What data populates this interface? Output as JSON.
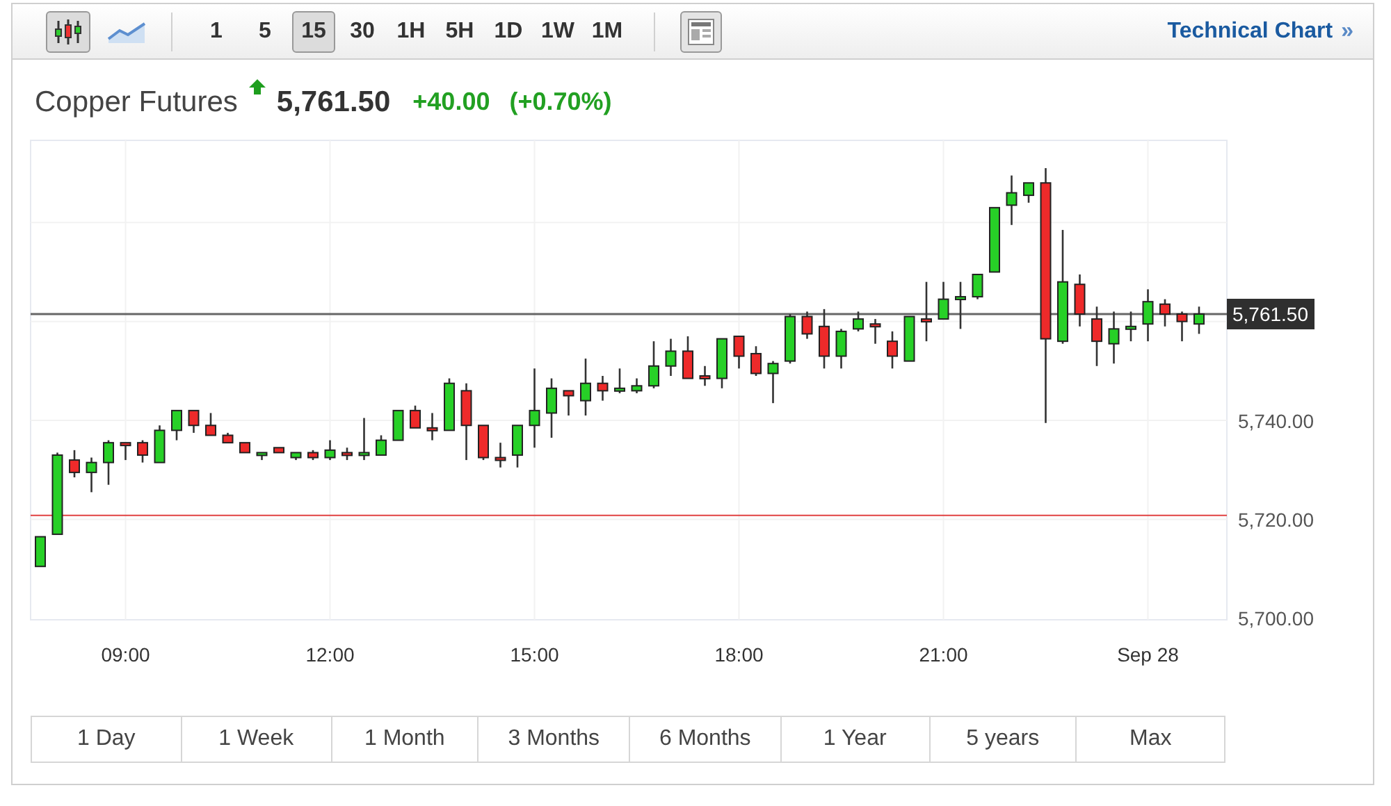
{
  "toolbar": {
    "chart_types": [
      {
        "kind": "candlestick",
        "selected": true
      },
      {
        "kind": "line",
        "selected": false
      }
    ],
    "timeframes": [
      {
        "label": "1",
        "selected": false
      },
      {
        "label": "5",
        "selected": false
      },
      {
        "label": "15",
        "selected": true
      },
      {
        "label": "30",
        "selected": false
      },
      {
        "label": "1H",
        "selected": false
      },
      {
        "label": "5H",
        "selected": false
      },
      {
        "label": "1D",
        "selected": false
      },
      {
        "label": "1W",
        "selected": false
      },
      {
        "label": "1M",
        "selected": false
      }
    ],
    "link": {
      "label": "Technical Chart",
      "arrow": "»"
    }
  },
  "quote": {
    "name": "Copper Futures",
    "rising": true,
    "price": "5,761.50",
    "change": "+40.00",
    "change_percent": "(+0.70%)"
  },
  "chart": {
    "chart_data": {
      "type": "candlestick",
      "categories": [
        null,
        null,
        null,
        null,
        null,
        "09:00",
        null,
        null,
        null,
        null,
        null,
        null,
        null,
        null,
        null,
        null,
        null,
        "12:00",
        null,
        null,
        null,
        null,
        null,
        null,
        null,
        null,
        null,
        null,
        null,
        "15:00",
        null,
        null,
        null,
        null,
        null,
        null,
        null,
        null,
        null,
        null,
        null,
        "18:00",
        null,
        null,
        null,
        null,
        null,
        null,
        null,
        null,
        null,
        null,
        null,
        "21:00",
        null,
        null,
        null,
        null,
        null,
        null,
        null,
        null,
        null,
        null,
        null,
        "Sep 28",
        null,
        null,
        null
      ],
      "ohlc": [
        [
          5710.5,
          5716.5,
          5710.5,
          5716.5
        ],
        [
          5717,
          5733.5,
          5717,
          5733
        ],
        [
          5732,
          5734,
          5728.5,
          5729.5
        ],
        [
          5729.5,
          5732.5,
          5725.5,
          5731.5
        ],
        [
          5731.5,
          5736,
          5727,
          5735.5
        ],
        [
          5735.5,
          5735.5,
          5732,
          5735
        ],
        [
          5735.5,
          5736,
          5731.5,
          5733
        ],
        [
          5731.5,
          5739,
          5731.5,
          5738
        ],
        [
          5738,
          5742,
          5736,
          5742
        ],
        [
          5742,
          5742,
          5737.5,
          5739
        ],
        [
          5739,
          5741.5,
          5737,
          5737
        ],
        [
          5737,
          5737.5,
          5735.5,
          5735.5
        ],
        [
          5735.5,
          5735.5,
          5733.5,
          5733.5
        ],
        [
          5733,
          5733.5,
          5732,
          5733.5
        ],
        [
          5734.5,
          5734.5,
          5733.5,
          5733.5
        ],
        [
          5732.5,
          5733.5,
          5732,
          5733.5
        ],
        [
          5733.5,
          5734,
          5732,
          5732.5
        ],
        [
          5732.5,
          5736,
          5732,
          5734
        ],
        [
          5733.5,
          5734.5,
          5732,
          5733
        ],
        [
          5733,
          5740.5,
          5732,
          5733.5
        ],
        [
          5733,
          5737,
          5733,
          5736
        ],
        [
          5736,
          5742,
          5736,
          5742
        ],
        [
          5742,
          5743,
          5738.5,
          5738.5
        ],
        [
          5738.5,
          5741.5,
          5736,
          5738
        ],
        [
          5738,
          5748.5,
          5738,
          5747.5
        ],
        [
          5746,
          5747.5,
          5732,
          5739
        ],
        [
          5739,
          5739,
          5732,
          5732.5
        ],
        [
          5732.5,
          5735.5,
          5730.5,
          5732
        ],
        [
          5733,
          5739,
          5730.5,
          5739
        ],
        [
          5739,
          5750.5,
          5734.5,
          5742
        ],
        [
          5741.5,
          5748.5,
          5736.5,
          5746.5
        ],
        [
          5746,
          5746,
          5741,
          5745
        ],
        [
          5744,
          5752.5,
          5741,
          5747.5
        ],
        [
          5747.5,
          5749,
          5744,
          5746
        ],
        [
          5746,
          5750.5,
          5745.5,
          5746.5
        ],
        [
          5746,
          5748.5,
          5745.5,
          5747
        ],
        [
          5747,
          5756,
          5746.5,
          5751
        ],
        [
          5751,
          5756.5,
          5749,
          5754
        ],
        [
          5754,
          5757,
          5748.5,
          5748.5
        ],
        [
          5749,
          5751,
          5747,
          5748.5
        ],
        [
          5748.5,
          5756.5,
          5746.5,
          5756.5
        ],
        [
          5757,
          5757,
          5750.5,
          5753
        ],
        [
          5753.5,
          5755,
          5749,
          5749.5
        ],
        [
          5749.5,
          5752,
          5743.5,
          5751.5
        ],
        [
          5752,
          5761.5,
          5751.5,
          5761
        ],
        [
          5761,
          5762,
          5756.5,
          5757.5
        ],
        [
          5759,
          5762.5,
          5750.5,
          5753
        ],
        [
          5753,
          5758.5,
          5750.5,
          5758
        ],
        [
          5758.5,
          5762,
          5758,
          5760.5
        ],
        [
          5759.5,
          5760.5,
          5755.5,
          5759
        ],
        [
          5756,
          5758,
          5750.5,
          5753
        ],
        [
          5752,
          5761,
          5752,
          5761
        ],
        [
          5760.5,
          5768,
          5756,
          5760
        ],
        [
          5760.5,
          5768,
          5760.5,
          5764.5
        ],
        [
          5764.5,
          5768,
          5758.5,
          5765
        ],
        [
          5765,
          5769.5,
          5764.5,
          5769.5
        ],
        [
          5770,
          5783,
          5770,
          5783
        ],
        [
          5783.5,
          5789.5,
          5779.5,
          5786
        ],
        [
          5785.5,
          5788,
          5784,
          5788
        ],
        [
          5788,
          5791,
          5739.5,
          5756.5
        ],
        [
          5756,
          5778.5,
          5755.5,
          5768
        ],
        [
          5767.5,
          5769.5,
          5759,
          5761.5
        ],
        [
          5760.5,
          5763,
          5751,
          5756
        ],
        [
          5755.5,
          5762,
          5751.5,
          5758.5
        ],
        [
          5758.5,
          5762,
          5756,
          5759
        ],
        [
          5759.5,
          5766.5,
          5756,
          5764
        ],
        [
          5763.5,
          5764.5,
          5759,
          5761.5
        ],
        [
          5761.5,
          5762,
          5756,
          5760
        ],
        [
          5759.5,
          5763,
          5757.5,
          5761.5
        ]
      ],
      "ylim": [
        5700,
        5796.6
      ],
      "yticks": [
        {
          "value": 5740,
          "label": "5,740.00"
        },
        {
          "value": 5720,
          "label": "5,720.00"
        },
        {
          "value": 5700,
          "label": "5,700.00"
        }
      ],
      "grid": true,
      "ref_lines": [
        {
          "axis": "y",
          "value": 5720.8,
          "color": "#e04040"
        },
        {
          "axis": "y",
          "value": 5761.5,
          "color": "#666666",
          "label": "5,761.50"
        }
      ]
    }
  },
  "ranges": [
    {
      "label": "1 Day",
      "selected": false
    },
    {
      "label": "1 Week",
      "selected": false
    },
    {
      "label": "1 Month",
      "selected": false
    },
    {
      "label": "3 Months",
      "selected": false
    },
    {
      "label": "6 Months",
      "selected": false
    },
    {
      "label": "1 Year",
      "selected": false
    },
    {
      "label": "5 years",
      "selected": false
    },
    {
      "label": "Max",
      "selected": false
    }
  ]
}
